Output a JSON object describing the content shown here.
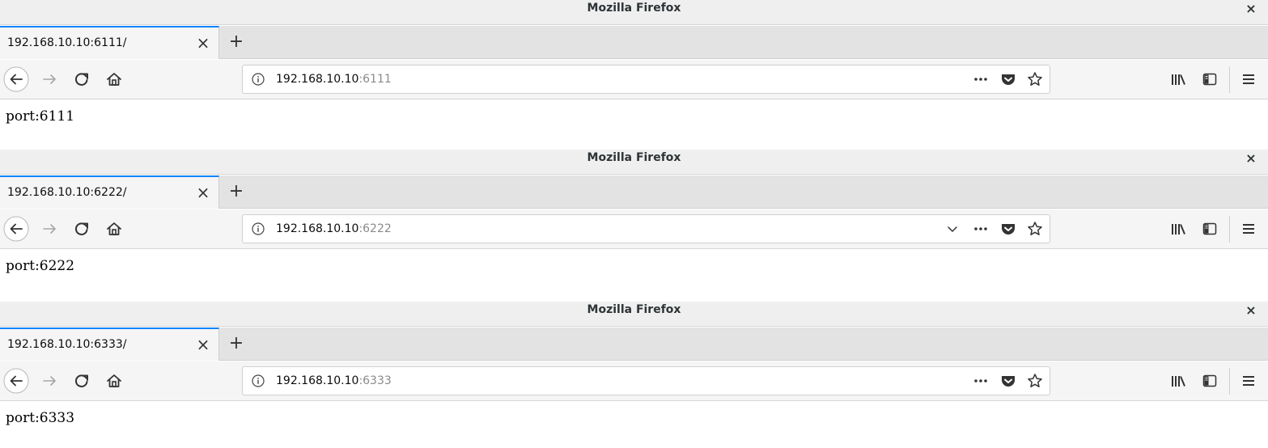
{
  "windows": [
    {
      "title": "Mozilla Firefox",
      "tab_label": "192.168.10.10:6111/",
      "url_host": "192.168.10.10",
      "url_port": ":6111",
      "show_dropdown": false,
      "page_text": "port:6111"
    },
    {
      "title": "Mozilla Firefox",
      "tab_label": "192.168.10.10:6222/",
      "url_host": "192.168.10.10",
      "url_port": ":6222",
      "show_dropdown": true,
      "page_text": "port:6222"
    },
    {
      "title": "Mozilla Firefox",
      "tab_label": "192.168.10.10:6333/",
      "url_host": "192.168.10.10",
      "url_port": ":6333",
      "show_dropdown": false,
      "page_text": "port:6333"
    }
  ],
  "glyphs": {
    "close_window": "×",
    "close_tab": "×",
    "new_tab": "+"
  },
  "colors": {
    "tab_accent": "#0a84ff",
    "chrome_background": "#f5f5f5",
    "tabstrip_background": "#e3e3e3"
  },
  "icons": [
    "back-icon",
    "forward-icon",
    "reload-icon",
    "home-icon",
    "info-icon",
    "dropdown-chevron-icon",
    "page-actions-icon",
    "pocket-icon",
    "bookmark-star-icon",
    "library-icon",
    "sidebar-icon",
    "hamburger-menu-icon"
  ]
}
